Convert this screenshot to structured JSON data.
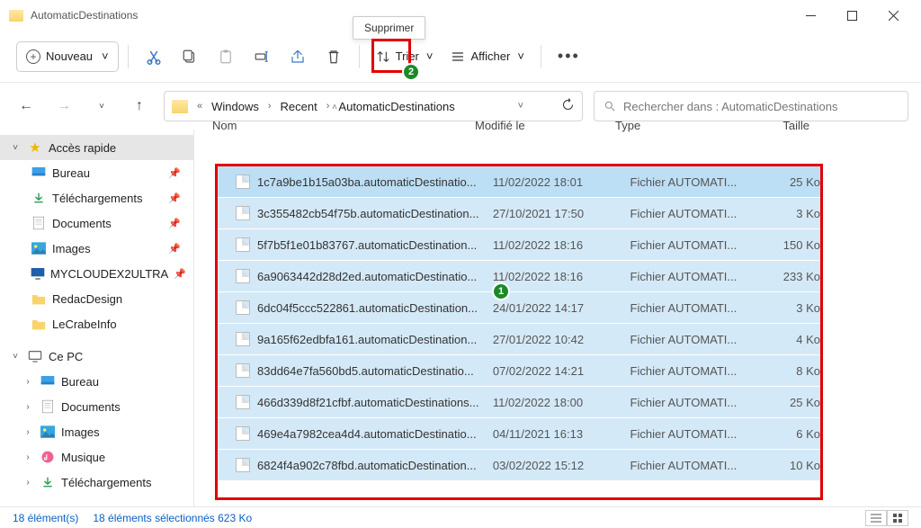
{
  "title": "AutomaticDestinations",
  "tooltip": "Supprimer",
  "badges": {
    "b1": "1",
    "b2": "2"
  },
  "toolbar": {
    "new": "Nouveau",
    "sort": "Trier",
    "view": "Afficher"
  },
  "breadcrumbs": [
    "Windows",
    "Recent",
    "AutomaticDestinations"
  ],
  "search_placeholder": "Rechercher dans : AutomaticDestinations",
  "sidebar": {
    "quick": "Accès rapide",
    "quick_items": [
      {
        "label": "Bureau",
        "pin": true,
        "icon": "desktop"
      },
      {
        "label": "Téléchargements",
        "pin": true,
        "icon": "download"
      },
      {
        "label": "Documents",
        "pin": true,
        "icon": "doc"
      },
      {
        "label": "Images",
        "pin": true,
        "icon": "image"
      },
      {
        "label": "MYCLOUDEX2ULTRA",
        "pin": true,
        "icon": "monitor"
      },
      {
        "label": "RedacDesign",
        "pin": false,
        "icon": "folder"
      },
      {
        "label": "LeCrabeInfo",
        "pin": false,
        "icon": "folder"
      }
    ],
    "pc": "Ce PC",
    "pc_items": [
      {
        "label": "Bureau",
        "icon": "desktop"
      },
      {
        "label": "Documents",
        "icon": "doc"
      },
      {
        "label": "Images",
        "icon": "image"
      },
      {
        "label": "Musique",
        "icon": "music"
      },
      {
        "label": "Téléchargements",
        "icon": "download"
      }
    ]
  },
  "columns": {
    "name": "Nom",
    "modified": "Modifié le",
    "type": "Type",
    "size": "Taille"
  },
  "files": [
    {
      "name": "1c7a9be1b15a03ba.automaticDestinatio...",
      "mod": "11/02/2022 18:01",
      "type": "Fichier AUTOMATI...",
      "size": "25 Ko"
    },
    {
      "name": "3c355482cb54f75b.automaticDestination...",
      "mod": "27/10/2021 17:50",
      "type": "Fichier AUTOMATI...",
      "size": "3 Ko"
    },
    {
      "name": "5f7b5f1e01b83767.automaticDestination...",
      "mod": "11/02/2022 18:16",
      "type": "Fichier AUTOMATI...",
      "size": "150 Ko"
    },
    {
      "name": "6a9063442d28d2ed.automaticDestinatio...",
      "mod": "11/02/2022 18:16",
      "type": "Fichier AUTOMATI...",
      "size": "233 Ko"
    },
    {
      "name": "6dc04f5ccc522861.automaticDestination...",
      "mod": "24/01/2022 14:17",
      "type": "Fichier AUTOMATI...",
      "size": "3 Ko"
    },
    {
      "name": "9a165f62edbfa161.automaticDestination...",
      "mod": "27/01/2022 10:42",
      "type": "Fichier AUTOMATI...",
      "size": "4 Ko"
    },
    {
      "name": "83dd64e7fa560bd5.automaticDestinatio...",
      "mod": "07/02/2022 14:21",
      "type": "Fichier AUTOMATI...",
      "size": "8 Ko"
    },
    {
      "name": "466d339d8f21cfbf.automaticDestinations...",
      "mod": "11/02/2022 18:00",
      "type": "Fichier AUTOMATI...",
      "size": "25 Ko"
    },
    {
      "name": "469e4a7982cea4d4.automaticDestinatio...",
      "mod": "04/11/2021 16:13",
      "type": "Fichier AUTOMATI...",
      "size": "6 Ko"
    },
    {
      "name": "6824f4a902c78fbd.automaticDestination...",
      "mod": "03/02/2022 15:12",
      "type": "Fichier AUTOMATI...",
      "size": "10 Ko"
    }
  ],
  "status": {
    "count": "18 élément(s)",
    "selected": "18 éléments sélectionnés  623 Ko"
  }
}
